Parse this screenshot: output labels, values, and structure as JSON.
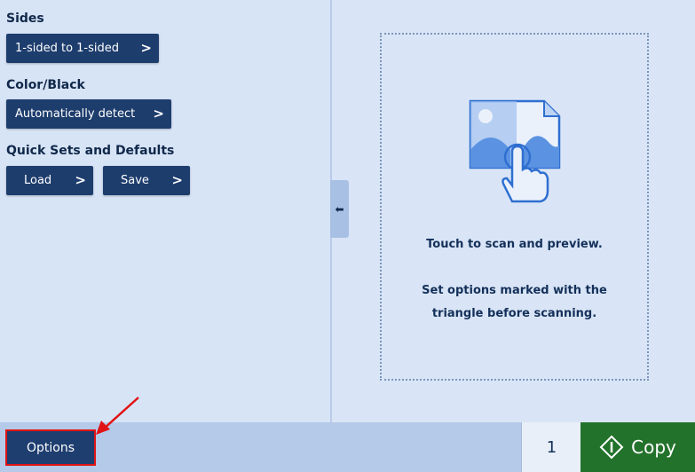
{
  "left": {
    "sides": {
      "label": "Sides",
      "value": "1-sided to 1-sided"
    },
    "color": {
      "label": "Color/Black",
      "value": "Automatically detect"
    },
    "quick_sets": {
      "label": "Quick Sets and Defaults",
      "load": "Load",
      "save": "Save"
    },
    "chevron": ">"
  },
  "collapse_tab": {
    "icon": "arrow-left-icon",
    "glyph": "⬅"
  },
  "preview": {
    "icon": "touch-scan-preview-icon",
    "line1": "Touch to scan and preview.",
    "line2": "Set options marked with the",
    "line3": "triangle before scanning."
  },
  "bottom": {
    "options": "Options",
    "count": "1",
    "copy": "Copy",
    "copy_icon": "start-diamond-icon"
  },
  "colors": {
    "dark_button": "#1d3d6d",
    "copy_green": "#23722b",
    "annotation_red": "#e01414",
    "background": "#d4e2f5"
  }
}
